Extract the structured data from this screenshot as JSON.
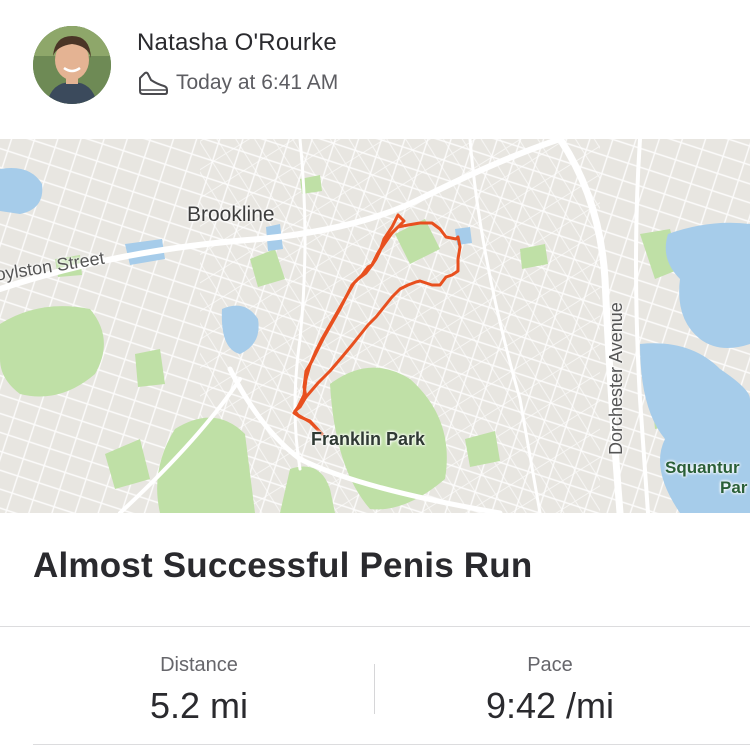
{
  "athlete": {
    "name": "Natasha O'Rourke",
    "avatar_icon": "profile-photo",
    "activity_icon": "running-shoe-icon",
    "timestamp": "Today at 6:41 AM"
  },
  "map": {
    "labels": {
      "brookline": "Brookline",
      "boylston": "oylston Street",
      "franklin_park": "Franklin Park",
      "dorchester": "Dorchester Avenue",
      "squantum_line1": "Squantur",
      "squantum_line2": "Par"
    },
    "route_color": "#e8501f",
    "park_color": "#b8dca0",
    "water_color": "#a8cdea"
  },
  "activity": {
    "title": "Almost Successful Penis Run"
  },
  "stats": {
    "distance_label": "Distance",
    "distance_value": "5.2 mi",
    "pace_label": "Pace",
    "pace_value": "9:42 /mi"
  }
}
